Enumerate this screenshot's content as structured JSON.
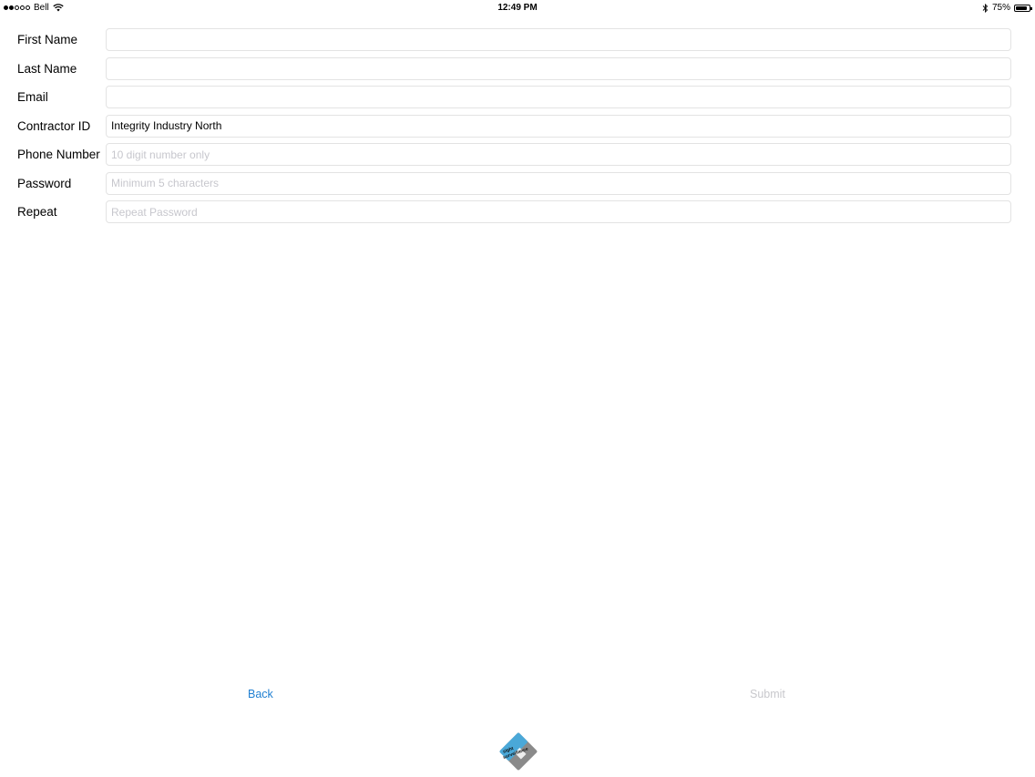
{
  "status_bar": {
    "carrier": "Bell",
    "time": "12:49 PM",
    "battery": "75%"
  },
  "form": {
    "fields": [
      {
        "label": "First Name",
        "value": "",
        "placeholder": ""
      },
      {
        "label": "Last Name",
        "value": "",
        "placeholder": ""
      },
      {
        "label": "Email",
        "value": "",
        "placeholder": ""
      },
      {
        "label": "Contractor ID",
        "value": "Integrity Industry North",
        "placeholder": ""
      },
      {
        "label": "Phone Number",
        "value": "",
        "placeholder": "10 digit number only"
      },
      {
        "label": "Password",
        "value": "",
        "placeholder": "Minimum 5 characters"
      },
      {
        "label": "Repeat",
        "value": "",
        "placeholder": "Repeat Password"
      }
    ]
  },
  "buttons": {
    "back": "Back",
    "submit": "Submit"
  },
  "logo": {
    "line1": "sight",
    "line2": "surveillance"
  },
  "colors": {
    "link_blue": "#1f7fd1",
    "disabled_gray": "#c8c8cc",
    "logo_blue": "#4aa8d8",
    "logo_gray": "#8a8a8a"
  }
}
